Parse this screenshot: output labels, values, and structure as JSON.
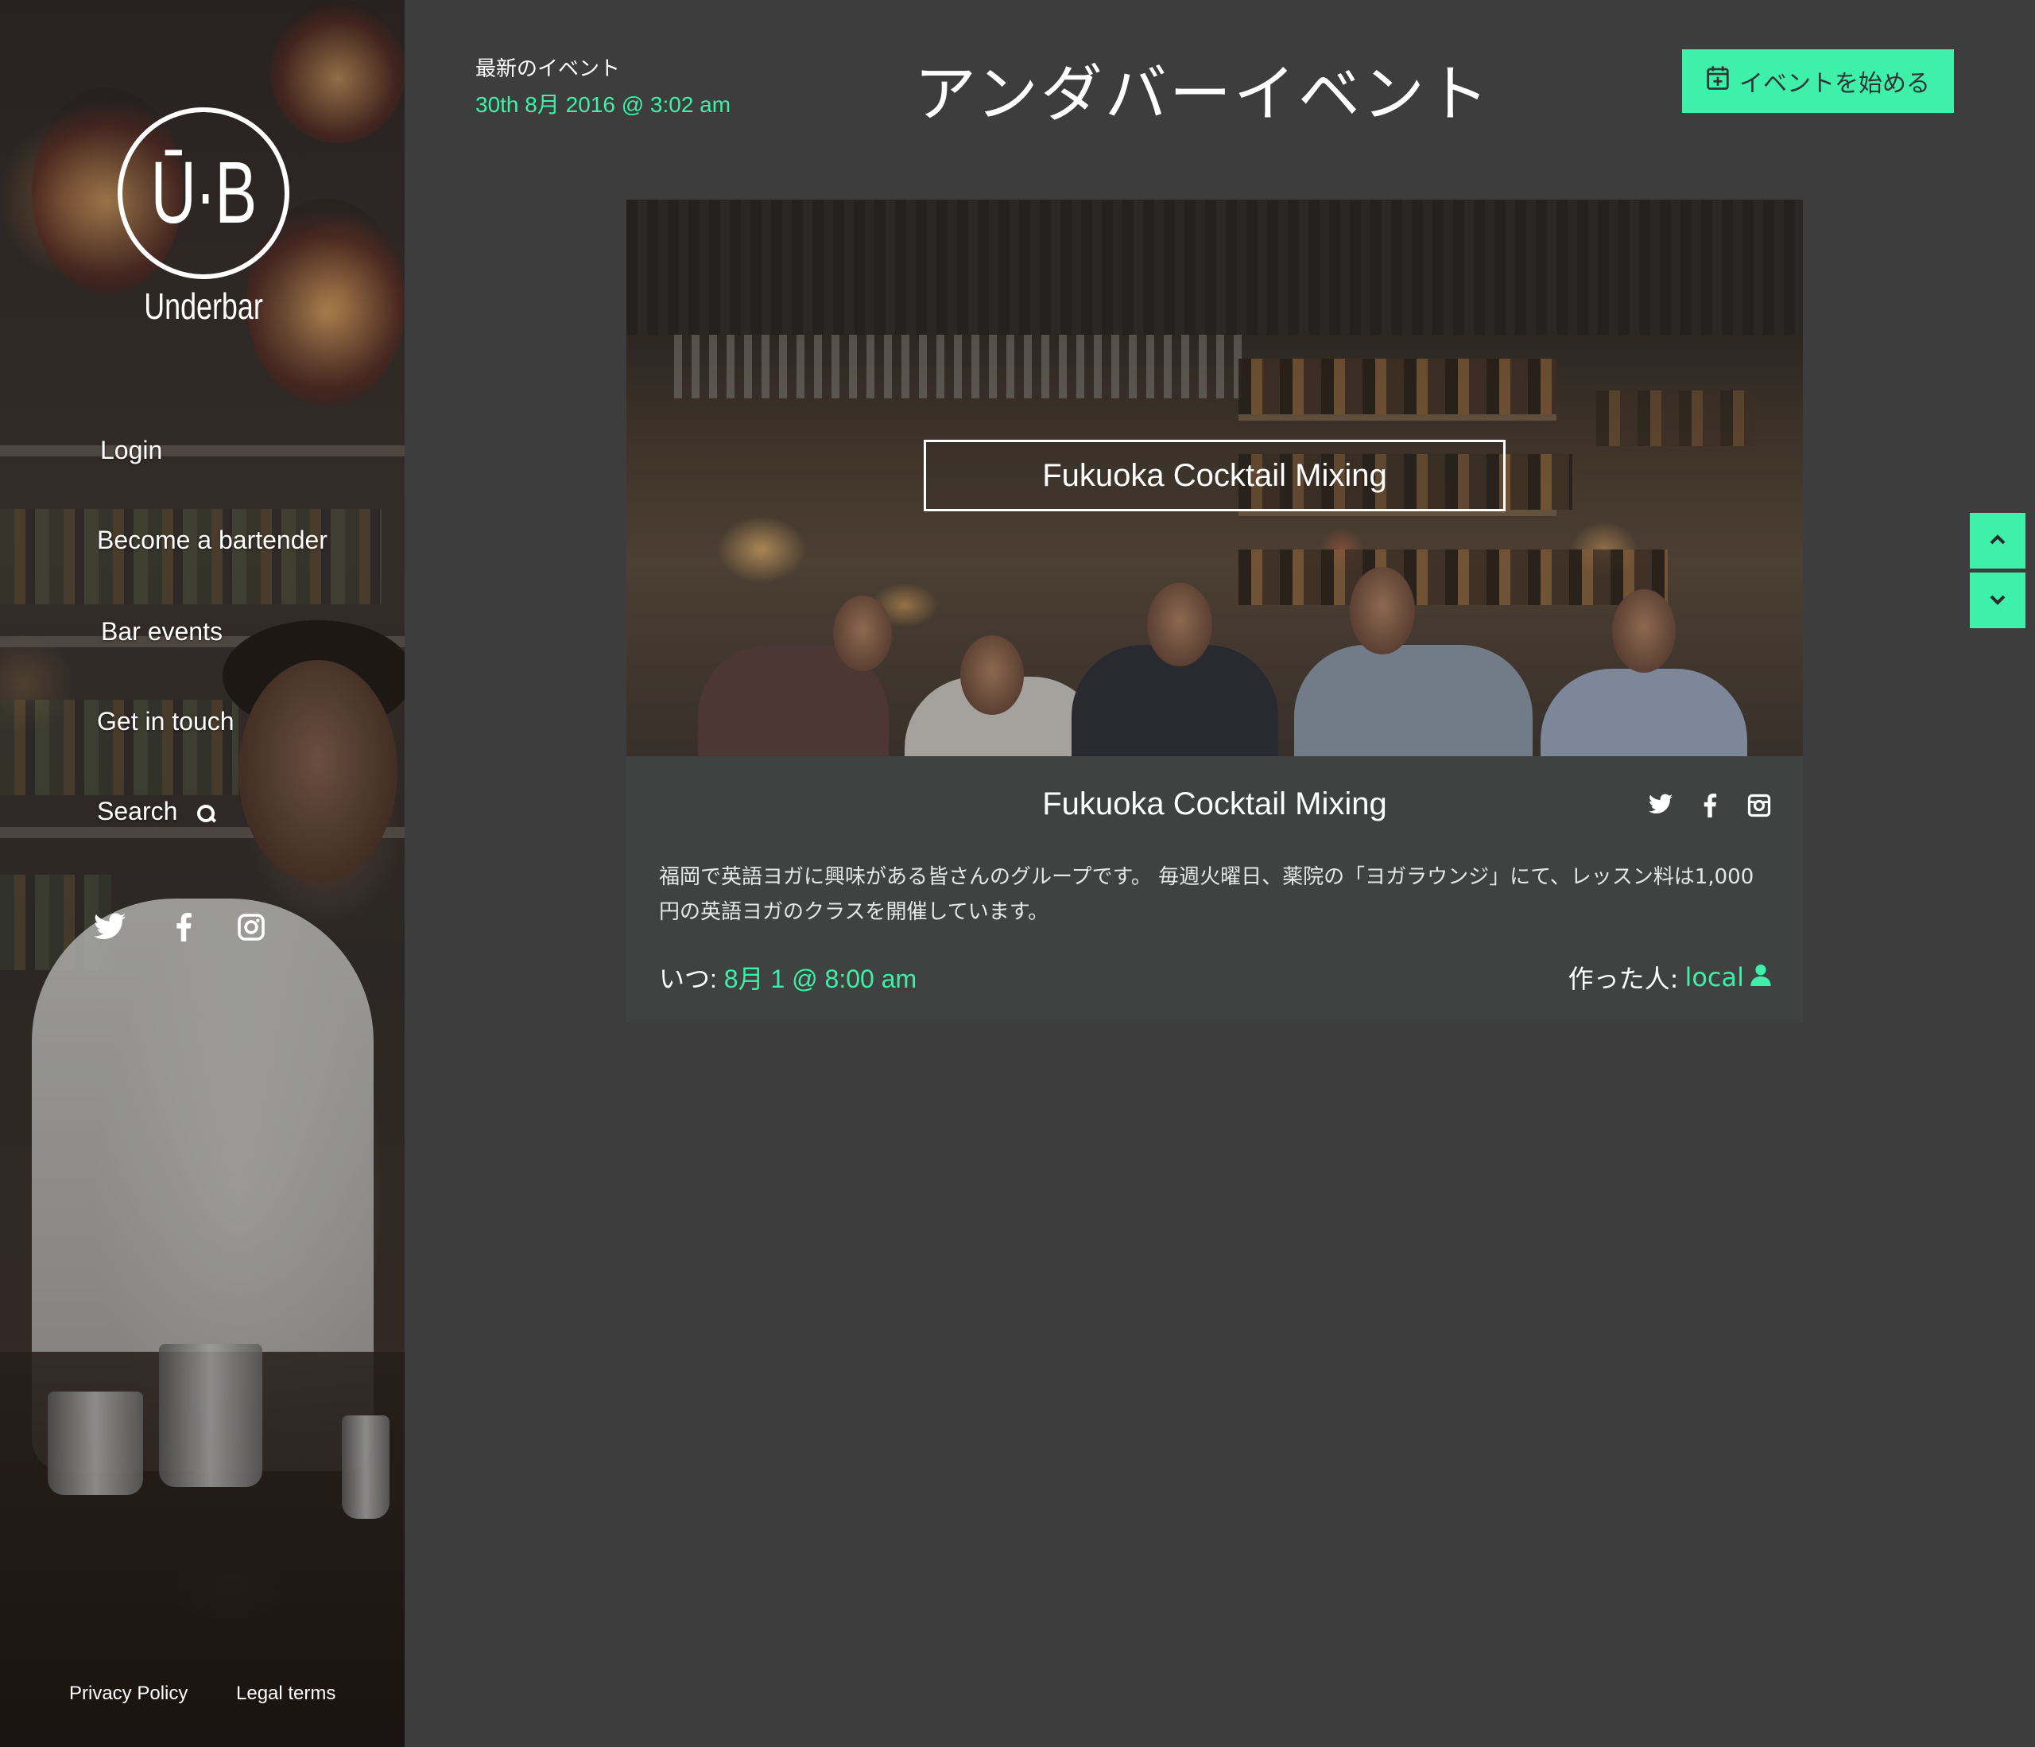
{
  "brand": {
    "logo_mark": "Ū·B",
    "name": "Underbar"
  },
  "nav": {
    "items": [
      {
        "label": "Login"
      },
      {
        "label": "Become a bartender"
      },
      {
        "label": "Bar events"
      },
      {
        "label": "Get in touch"
      },
      {
        "label": "Search"
      }
    ],
    "social": [
      "twitter-icon",
      "facebook-icon",
      "instagram-icon"
    ]
  },
  "footer": {
    "privacy": "Privacy Policy",
    "legal": "Legal terms"
  },
  "header": {
    "latest_label": "最新のイベント",
    "latest_date": "30th 8月 2016 @ 3:02 am",
    "title": "アンダバーイベント",
    "start_button": "イベントを始める",
    "start_icon": "calendar-plus-icon"
  },
  "event": {
    "image_title": "Fukuoka Cocktail Mixing",
    "title": "Fukuoka Cocktail Mixing",
    "description": "福岡で英語ヨガに興味がある皆さんのグループです。 毎週火曜日、薬院の「ヨガラウンジ」にて、レッスン料は1,000円の英語ヨガのクラスを開催しています。",
    "when_label": "いつ:",
    "when_value": "8月 1 @ 8:00 am",
    "creator_label": "作った人:",
    "creator_value": "local",
    "share": [
      "twitter-icon",
      "facebook-icon",
      "instagram-icon"
    ]
  },
  "colors": {
    "accent": "#3ef0a9",
    "background": "#3c3d3c",
    "card": "#3f4241"
  }
}
